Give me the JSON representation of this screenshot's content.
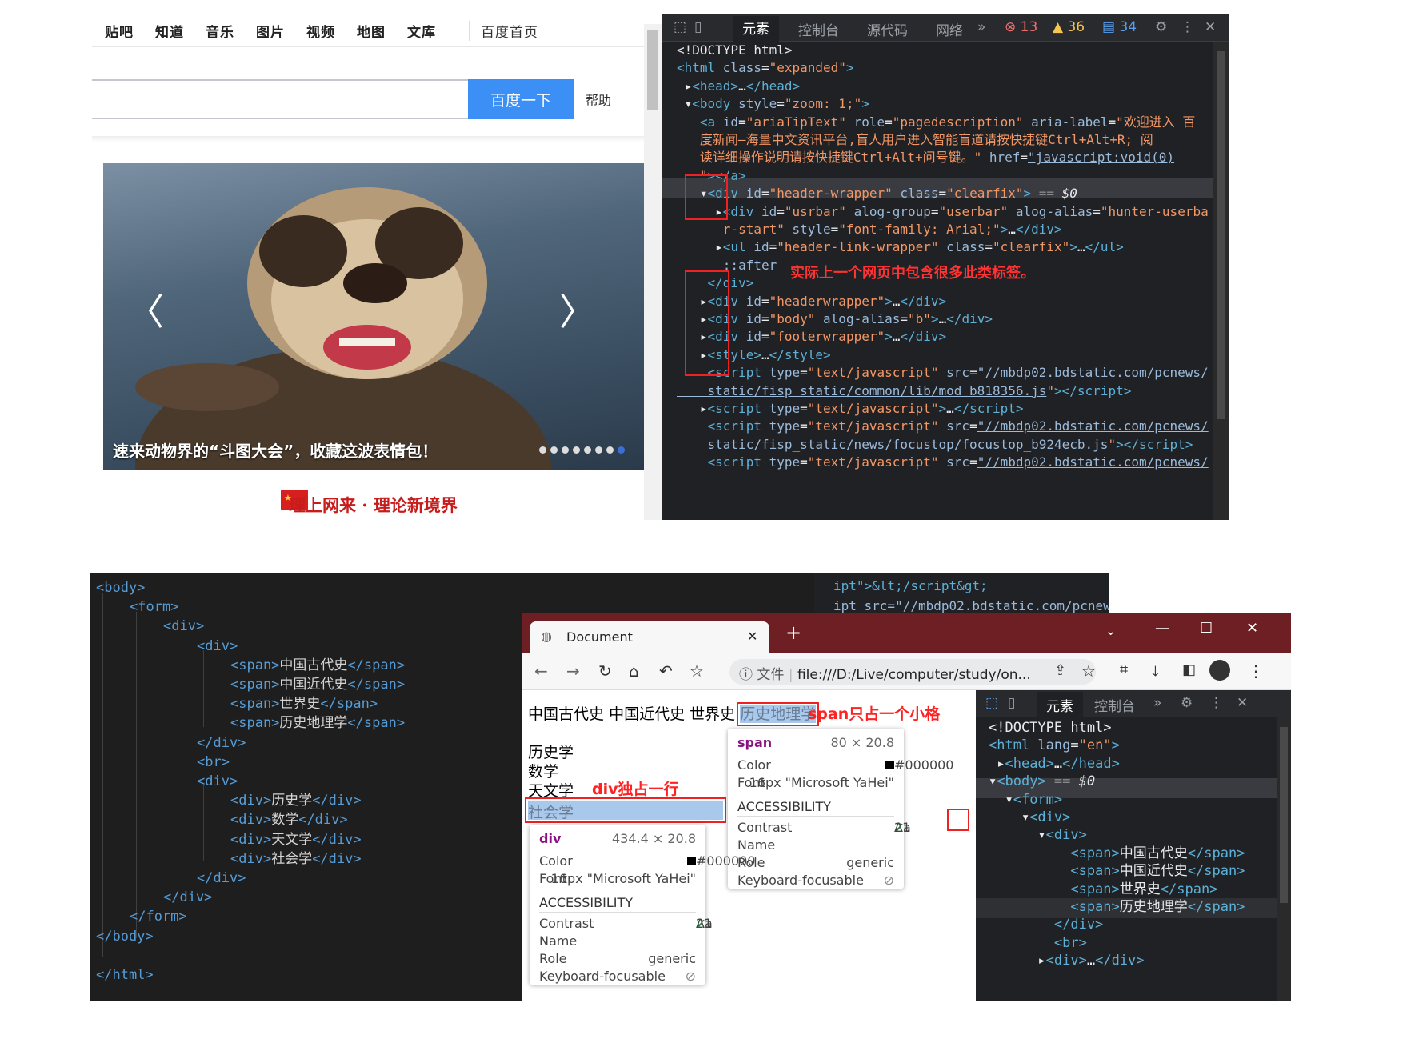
{
  "baidu": {
    "nav": [
      "贴吧",
      "知道",
      "音乐",
      "图片",
      "视频",
      "地图",
      "文库"
    ],
    "home_link": "百度首页",
    "search_button": "百度一下",
    "help_link": "帮助",
    "slide_caption": "速来动物界的“斗图大会”，收藏这波表情包！",
    "prev_arrow": "〈",
    "next_arrow": "〉",
    "slide_count": 8,
    "active_slide": 8,
    "banner": "理上网来 · 理论新境界"
  },
  "devtools_top": {
    "tabs": [
      "元素",
      "控制台",
      "源代码",
      "网络",
      "»"
    ],
    "errors": "13",
    "warnings": "36",
    "messages": "34",
    "lines": [
      {
        "html": "<span class='tx'>&lt;!DOCTYPE html&gt;</span>"
      },
      {
        "html": "<span class='tg'>&lt;html </span><span class='at'>class</span><span class='tx'>=</span><span class='av'>\"expanded\"</span><span class='tg'>&gt;</span>"
      },
      {
        "html": "<span class='tx'> ▸</span><span class='tg'>&lt;head&gt;</span><span class='tx'>…</span><span class='tg'>&lt;/head&gt;</span>"
      },
      {
        "html": "<span class='tx'> ▾</span><span class='tg'>&lt;body </span><span class='at'>style</span><span class='tx'>=</span><span class='av'>\"zoom: 1;\"</span><span class='tg'>&gt;</span>"
      },
      {
        "html": "<span class='tg'>   &lt;a </span><span class='at'>id</span><span class='tx'>=</span><span class='av'>\"ariaTipText\"</span><span class='at'> role</span><span class='tx'>=</span><span class='av'>\"pagedescription\"</span><span class='at'> aria-label</span><span class='tx'>=</span><span class='av'>\"欢迎进入 百</span>"
      },
      {
        "html": "<span class='av'>   度新闻—海量中文资讯平台,盲人用户进入智能盲道请按快捷键Ctrl+Alt+R; 阅</span>"
      },
      {
        "html": "<span class='av'>   读详细操作说明请按快捷键Ctrl+Alt+问号键。\"</span><span class='at'> href</span><span class='tx'>=</span><span class='lk'>\"javascript:void(0)</span>"
      },
      {
        "html": "<span class='av'>   \"</span><span class='tg'>&gt;&lt;/a&gt;</span>"
      },
      {
        "html": "<span class='tx'>   ▾</span><span class='tg'>&lt;div </span><span class='at'>id</span><span class='tx'>=</span><span class='av'>\"header-wrapper\"</span><span class='at'> class</span><span class='tx'>=</span><span class='av'>\"clearfix\"</span><span class='tg'>&gt;</span><span class='cm'> == </span><span class='tx'><i>$0</i></span>"
      },
      {
        "html": "<span class='tx'>     ▸</span><span class='tg'>&lt;div </span><span class='at'>id</span><span class='tx'>=</span><span class='av'>\"usrbar\"</span><span class='at'> alog-group</span><span class='tx'>=</span><span class='av'>\"userbar\"</span><span class='at'> alog-alias</span><span class='tx'>=</span><span class='av'>\"hunter-userba</span>"
      },
      {
        "html": "<span class='av'>      r-start\"</span><span class='at'> style</span><span class='tx'>=</span><span class='av'>\"font-family: Arial;\"</span><span class='tg'>&gt;</span><span class='tx'>…</span><span class='tg'>&lt;/div&gt;</span>"
      },
      {
        "html": "<span class='tx'>     ▸</span><span class='tg'>&lt;ul </span><span class='at'>id</span><span class='tx'>=</span><span class='av'>\"header-link-wrapper\"</span><span class='at'> class</span><span class='tx'>=</span><span class='av'>\"clearfix\"</span><span class='tg'>&gt;</span><span class='tx'>…</span><span class='tg'>&lt;/ul&gt;</span>"
      },
      {
        "html": "<span class='at'>      ::after</span>"
      },
      {
        "html": "<span class='tg'>    &lt;/div&gt;</span>"
      },
      {
        "html": "<span class='tx'>   ▸</span><span class='tg'>&lt;div </span><span class='at'>id</span><span class='tx'>=</span><span class='av'>\"headerwrapper\"</span><span class='tg'>&gt;</span><span class='tx'>…</span><span class='tg'>&lt;/div&gt;</span>"
      },
      {
        "html": "<span class='tx'>   ▸</span><span class='tg'>&lt;div </span><span class='at'>id</span><span class='tx'>=</span><span class='av'>\"body\"</span><span class='at'> alog-alias</span><span class='tx'>=</span><span class='av'>\"b\"</span><span class='tg'>&gt;</span><span class='tx'>…</span><span class='tg'>&lt;/div&gt;</span>"
      },
      {
        "html": "<span class='tx'>   ▸</span><span class='tg'>&lt;div </span><span class='at'>id</span><span class='tx'>=</span><span class='av'>\"footerwrapper\"</span><span class='tg'>&gt;</span><span class='tx'>…</span><span class='tg'>&lt;/div&gt;</span>"
      },
      {
        "html": "<span class='tx'>   ▸</span><span class='tg'>&lt;style&gt;</span><span class='tx'>…</span><span class='tg'>&lt;/style&gt;</span>"
      },
      {
        "html": "<span class='tg'>    &lt;script </span><span class='at'>type</span><span class='tx'>=</span><span class='av'>\"text/javascript\"</span><span class='at'> src</span><span class='tx'>=</span><span class='lk'>\"//mbdp02.bdstatic.com/pcnews/</span>"
      },
      {
        "html": "<span class='lk'>    static/fisp_static/common/lib/mod_b818356.js</span><span class='av'>\"</span><span class='tg'>&gt;&lt;/script&gt;</span>"
      },
      {
        "html": "<span class='tx'>   ▸</span><span class='tg'>&lt;script </span><span class='at'>type</span><span class='tx'>=</span><span class='av'>\"text/javascript\"</span><span class='tg'>&gt;</span><span class='tx'>…</span><span class='tg'>&lt;/script&gt;</span>"
      },
      {
        "html": "<span class='tg'>    &lt;script </span><span class='at'>type</span><span class='tx'>=</span><span class='av'>\"text/javascript\"</span><span class='at'> src</span><span class='tx'>=</span><span class='lk'>\"//mbdp02.bdstatic.com/pcnews/</span>"
      },
      {
        "html": "<span class='lk'>    static/fisp_static/news/focustop/focustop_b924ecb.js</span><span class='av'>\"</span><span class='tg'>&gt;&lt;/script&gt;</span>"
      },
      {
        "html": "<span class='tg'>    &lt;script </span><span class='at'>type</span><span class='tx'>=</span><span class='av'>\"text/javascript\"</span><span class='at'> src</span><span class='tx'>=</span><span class='lk'>\"//mbdp02.bdstatic.com/pcnews/</span>"
      }
    ],
    "annotation": "实际上一个网页中包含很多此类标签。"
  },
  "editor": {
    "lines": [
      {
        "indent": 0,
        "html": "<span class='t'>&lt;body&gt;</span>"
      },
      {
        "indent": 1,
        "html": "<span class='t'>&lt;form&gt;</span>"
      },
      {
        "indent": 2,
        "html": "<span class='t'>&lt;div&gt;</span>"
      },
      {
        "indent": 3,
        "html": "<span class='t'>&lt;div&gt;</span>"
      },
      {
        "indent": 4,
        "html": "<span class='t'>&lt;span&gt;</span>中国古代史<span class='t'>&lt;/span&gt;</span>"
      },
      {
        "indent": 4,
        "html": "<span class='t'>&lt;span&gt;</span>中国近代史<span class='t'>&lt;/span&gt;</span>"
      },
      {
        "indent": 4,
        "html": "<span class='t'>&lt;span&gt;</span>世界史<span class='t'>&lt;/span&gt;</span>"
      },
      {
        "indent": 4,
        "html": "<span class='t'>&lt;span&gt;</span>历史地理学<span class='t'>&lt;/span&gt;</span>"
      },
      {
        "indent": 3,
        "html": "<span class='t'>&lt;/div&gt;</span>"
      },
      {
        "indent": 3,
        "html": "<span class='t'>&lt;br&gt;</span>"
      },
      {
        "indent": 3,
        "html": "<span class='t'>&lt;div&gt;</span>"
      },
      {
        "indent": 4,
        "html": "<span class='t'>&lt;div&gt;</span>历史学<span class='t'>&lt;/div&gt;</span>"
      },
      {
        "indent": 4,
        "html": "<span class='t'>&lt;div&gt;</span>数学<span class='t'>&lt;/div&gt;</span>"
      },
      {
        "indent": 4,
        "html": "<span class='t'>&lt;div&gt;</span>天文学<span class='t'>&lt;/div&gt;</span>"
      },
      {
        "indent": 4,
        "html": "<span class='t'>&lt;div&gt;</span>社会学<span class='t'>&lt;/div&gt;</span>"
      },
      {
        "indent": 3,
        "html": "<span class='t'>&lt;/div&gt;</span>"
      },
      {
        "indent": 2,
        "html": "<span class='t'>&lt;/div&gt;</span>"
      },
      {
        "indent": 1,
        "html": "<span class='t'>&lt;/form&gt;</span>"
      },
      {
        "indent": 0,
        "html": "<span class='t'>&lt;/body&gt;</span>"
      },
      {
        "indent": 0,
        "html": ""
      },
      {
        "indent": 0,
        "html": "<span class='t'>&lt;/html&gt;</span>"
      }
    ],
    "bg_peek": [
      "ipt\">&lt;/script&gt;",
      "ipt src=\"//mbdp02.bdstatic.com/pcnews/"
    ]
  },
  "browser": {
    "tab_title": "Document",
    "new_tab": "+",
    "file_label": "文件",
    "url": "file:///D:/Live/computer/study/on...",
    "spans": [
      "中国古代史",
      "中国近代史",
      "世界史",
      "历史地理学"
    ],
    "divs": [
      "历史学",
      "数学",
      "天文学",
      "社会学"
    ],
    "span_note": "span只占一个小格",
    "div_note": "div独占一行",
    "span_tip": {
      "tag": "span",
      "size": "80 × 20.8",
      "color_label": "Color",
      "color": "#000000",
      "font_label": "Font",
      "font": "16px \"Microsoft YaHei\"",
      "access": "ACCESSIBILITY",
      "contrast": "Contrast",
      "contrast_val": "21",
      "aa": "Aa",
      "name": "Name",
      "role": "Role",
      "role_val": "generic",
      "kbd": "Keyboard-focusable"
    },
    "div_tip": {
      "tag": "div",
      "size": "434.4 × 20.8",
      "color_label": "Color",
      "color": "#000000",
      "font_label": "Font",
      "font": "16px \"Microsoft YaHei\"",
      "access": "ACCESSIBILITY",
      "contrast": "Contrast",
      "contrast_val": "21",
      "aa": "Aa",
      "name": "Name",
      "role": "Role",
      "role_val": "generic",
      "kbd": "Keyboard-focusable"
    },
    "devtools_tabs": [
      "元素",
      "控制台",
      "»"
    ],
    "devtools_lines": [
      {
        "html": "<span class='tx'>&lt;!DOCTYPE html&gt;</span>"
      },
      {
        "html": "<span class='tg'>&lt;html </span><span class='at'>lang</span><span class='tx'>=</span><span class='av'>\"en\"</span><span class='tg'>&gt;</span>"
      },
      {
        "html": "<span class='tx'> ▸</span><span class='tg'>&lt;head&gt;</span><span class='tx'>…</span><span class='tg'>&lt;/head&gt;</span>"
      },
      {
        "html": "<span class='tx'>▾</span><span class='tg'>&lt;body&gt;</span><span class='cm'> == </span><span class='tx'><i>$0</i></span>"
      },
      {
        "html": "<span class='tx'>  ▾</span><span class='tg'>&lt;form&gt;</span>"
      },
      {
        "html": "<span class='tx'>    ▾</span><span class='tg'>&lt;div&gt;</span>"
      },
      {
        "html": "<span class='tx'>      ▾</span><span class='tg'>&lt;div&gt;</span>"
      },
      {
        "html": "<span class='tg'>          &lt;span&gt;</span><span class='tx'>中国古代史</span><span class='tg'>&lt;/span&gt;</span>"
      },
      {
        "html": "<span class='tg'>          &lt;span&gt;</span><span class='tx'>中国近代史</span><span class='tg'>&lt;/span&gt;</span>"
      },
      {
        "html": "<span class='tg'>          &lt;span&gt;</span><span class='tx'>世界史</span><span class='tg'>&lt;/span&gt;</span>"
      },
      {
        "html": "<span class='tg'>          &lt;span&gt;</span><span class='tx'>历史地理学</span><span class='tg'>&lt;/span&gt;</span>"
      },
      {
        "html": "<span class='tg'>        &lt;/div&gt;</span>"
      },
      {
        "html": "<span class='tg'>        &lt;br&gt;</span>"
      },
      {
        "html": "<span class='tx'>      ▸</span><span class='tg'>&lt;div&gt;</span><span class='tx'>…</span><span class='tg'>&lt;/div&gt;</span>"
      }
    ]
  }
}
